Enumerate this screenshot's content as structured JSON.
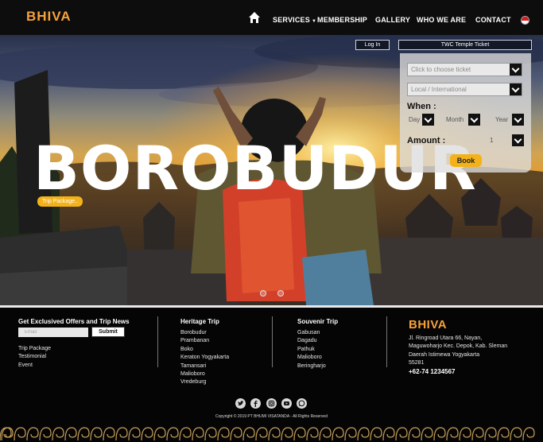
{
  "header": {
    "logo": "BHIVA",
    "nav": [
      {
        "label": "SERVICES",
        "has_caret": true
      },
      {
        "label": "MEMBERSHIP"
      },
      {
        "label": "GALLERY"
      },
      {
        "label": "WHO WE ARE"
      },
      {
        "label": "CONTACT"
      }
    ],
    "home_icon": "home-icon",
    "language_icon": "indonesia-flag-icon"
  },
  "hero": {
    "title": "BOROBUDUR",
    "badge": "Trip Package.."
  },
  "booking": {
    "login_label": "Log In",
    "tab_label": "TWC Temple Ticket",
    "ticket_placeholder": "Click to choose ticket",
    "origin_value": "Local / International",
    "when_label": "When :",
    "day_placeholder": "Day",
    "month_placeholder": "Month",
    "year_placeholder": "Year",
    "amount_label": "Amount :",
    "amount_value": "1",
    "book_label": "Book"
  },
  "footer": {
    "newsletter_heading": "Get Exclusived Offers and Trip News",
    "email_placeholder": "Email",
    "submit_label": "Submit",
    "links": [
      "Trip Package",
      "Testimonial",
      "Event"
    ],
    "heritage_heading": "Heritage Trip",
    "heritage_items": [
      "Borobudur",
      "Prambanan",
      "Boko",
      "Keraton Yogyakarta",
      "Tamansari",
      "Malioboro",
      "Vredeburg"
    ],
    "souvenir_heading": "Souvenir Trip",
    "souvenir_items": [
      "Gabusan",
      "Dagadu",
      "Pathuk",
      "Malioboro",
      "Beringharjo"
    ],
    "company": "BHIVA",
    "address": [
      "Jl. Ringroad Utara 66, Nayan,",
      "Maguwoharjo Kec. Depok, Kab. Sleman",
      "Daerah Istimewa Yogyakarta",
      "55281"
    ],
    "phone": "+62-74 1234567",
    "social_icons": [
      "twitter-icon",
      "facebook-icon",
      "instagram-icon",
      "youtube-icon",
      "whatsapp-icon"
    ],
    "copyright": "Copyright © 2019 PT BHUMI VISATANDA - All Rights Reserved"
  },
  "colors": {
    "accent": "#f7a23a",
    "badge": "#f3b21a",
    "header_bg": "#0d0d0d"
  }
}
